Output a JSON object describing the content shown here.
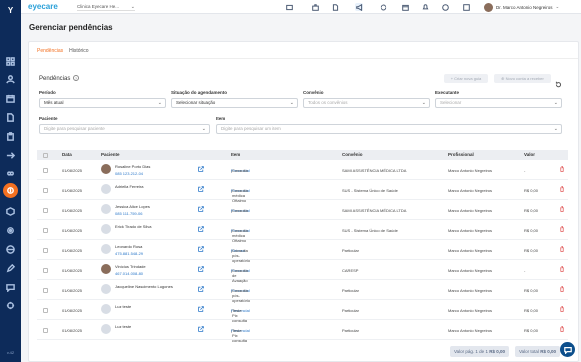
{
  "brand": "eyecare",
  "clinic": "Clinica Eyecare He...",
  "user": "Dr. Marco Antonio Negreiros",
  "version": "v.42",
  "page_title": "Gerenciar pendências",
  "tabs": [
    {
      "label": "Pendências"
    },
    {
      "label": "Histórico"
    }
  ],
  "section_title": "Pendências",
  "buttons": {
    "create": "+ Criar nova guia",
    "send": "⊕ Novo conta a receber"
  },
  "filters": {
    "periodo": {
      "label": "Período",
      "value": "Mês atual"
    },
    "situacao": {
      "label": "Situação do agendamento",
      "value": "Selecionar situação"
    },
    "convenio": {
      "label": "Convênio",
      "placeholder": "Todos os convênios"
    },
    "executante": {
      "label": "Executante",
      "placeholder": "Selecionar"
    },
    "paciente": {
      "label": "Paciente",
      "placeholder": "Digite para pesquisar paciente"
    },
    "item": {
      "label": "Item",
      "placeholder": "Digite para pesquisar um item"
    }
  },
  "table": {
    "headers": {
      "data": "Data",
      "paciente": "Paciente",
      "item": "Item",
      "convenio": "Convênio",
      "profissional": "Profissional",
      "valor": "Valor"
    },
    "rows": [
      {
        "date": "01/08/2025",
        "patient": "Rosaline Porto Dias",
        "phone": "085 123.212-04",
        "item_type": "Presencial",
        "item_name": "Consulta",
        "convenio": "SAMI ASSISTÊNCIA MÉDICA LTDA",
        "prof": "Marco Antonio Negreiros",
        "valor": "-",
        "photo": true
      },
      {
        "date": "01/08/2025",
        "patient": "Adriella Ferreira",
        "phone": "",
        "item_type": "Presencial",
        "item_name": "Consulta médica Oftalmo",
        "convenio": "SUS - Sistema Único de Saúde",
        "prof": "Marco Antonio Negreiros",
        "valor": "R$ 0,00",
        "photo": false
      },
      {
        "date": "01/08/2025",
        "patient": "Jessica Alice Lopes",
        "phone": "085 111.759-06",
        "item_type": "Presencial",
        "item_name": "Consulta",
        "convenio": "SAMI ASSISTÊNCIA MÉDICA LTDA",
        "prof": "Marco Antonio Negreiros",
        "valor": "R$ 0,00",
        "photo": false
      },
      {
        "date": "01/08/2025",
        "patient": "Erick Tirado de Silva",
        "phone": "",
        "item_type": "Presencial",
        "item_name": "Consulta médica Oftalmo",
        "convenio": "SUS - Sistema Único de Saúde",
        "prof": "Marco Antonio Negreiros",
        "valor": "R$ 0,00",
        "photo": false
      },
      {
        "date": "01/08/2025",
        "patient": "Leonardo Rosa",
        "phone": "475.881.548-29",
        "item_type": "Retorno",
        "item_name": "Consulta pós-operatório",
        "convenio": "Particular",
        "prof": "Marco Antonio Negreiros",
        "valor": "R$ 0,00",
        "photo": false
      },
      {
        "date": "01/08/2025",
        "patient": "Vinícius Trindade",
        "phone": "467.014.008-80",
        "item_type": "Presencial",
        "item_name": "Consulta de Avaação",
        "convenio": "CARESP",
        "prof": "Marco Antonio Negreiros",
        "valor": "-",
        "photo": true
      },
      {
        "date": "01/08/2025",
        "patient": "Jacqueline Nascimento Lugones",
        "phone": "",
        "item_type": "Presencial",
        "item_name": "Consulta pós-operatório",
        "convenio": "Particular",
        "prof": "Marco Antonio Negreiros",
        "valor": "R$ 0,00",
        "photo": false
      },
      {
        "date": "01/08/2025",
        "patient": "Luz teste",
        "phone": "",
        "item_type": "Presencial",
        "item_name": "Teste Pix consulta",
        "convenio": "Particular",
        "prof": "Marco Antonio Negreiros",
        "valor": "R$ 0,00",
        "photo": false
      },
      {
        "date": "01/08/2025",
        "patient": "Luz teste",
        "phone": "",
        "item_type": "Presencial",
        "item_name": "Teste Pix consulta",
        "convenio": "Particular",
        "prof": "Marco Antonio Negreiros",
        "valor": "R$ 0,00",
        "photo": false
      }
    ]
  },
  "footer": {
    "page_label": "Valor pág. 1 de 1",
    "page_value": "R$ 0,00",
    "total_label": "Valor total",
    "total_value": "R$ 0,00"
  },
  "colors": {
    "accent": "#f37021",
    "sidebar": "#0d2b5a",
    "link": "#2a77c9"
  }
}
